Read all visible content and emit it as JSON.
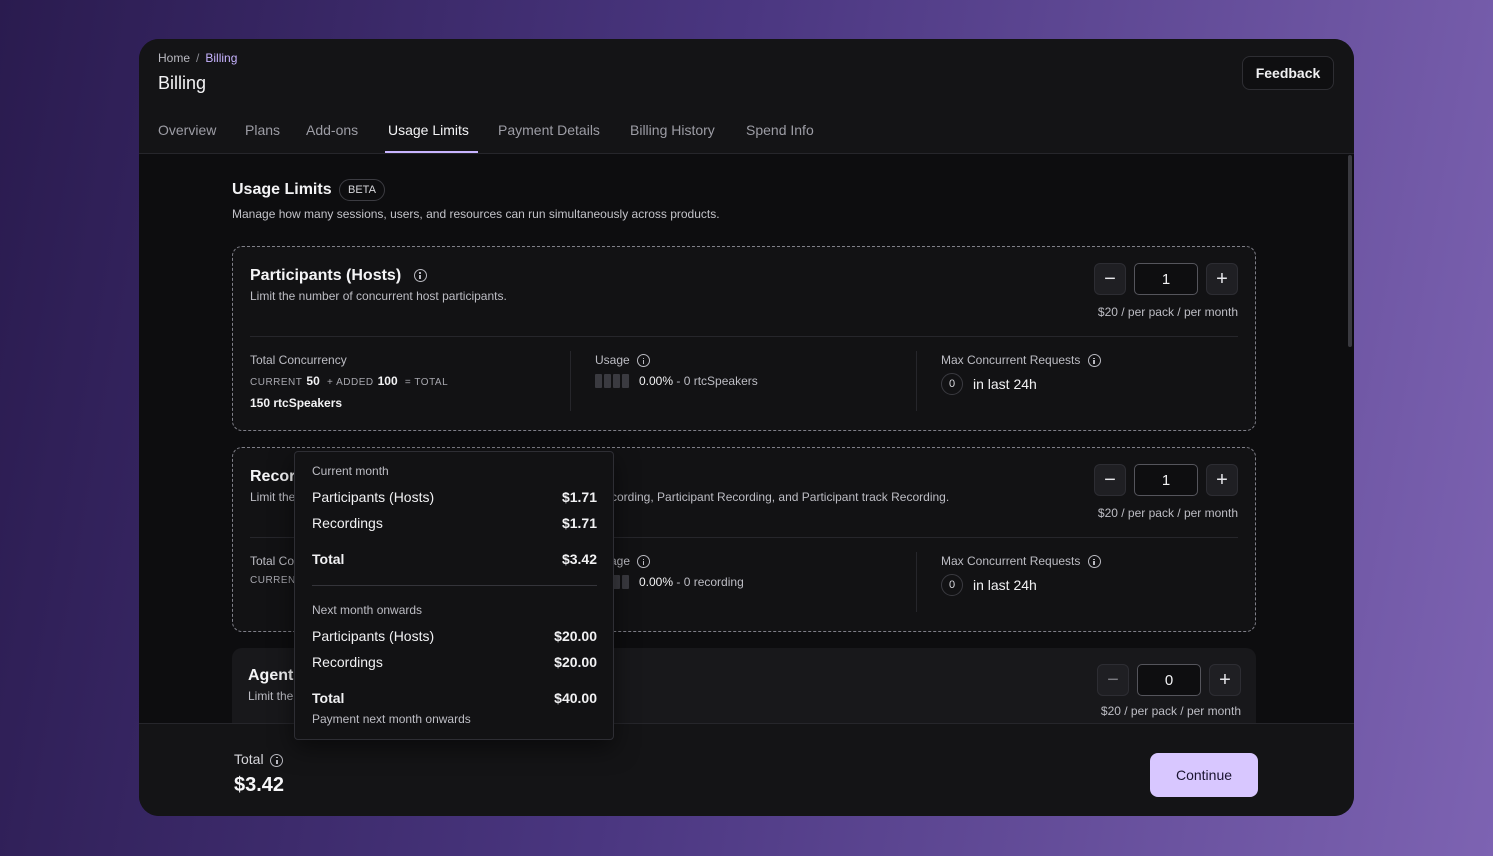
{
  "breadcrumb": {
    "home": "Home",
    "separator": "/",
    "current": "Billing"
  },
  "page_title": "Billing",
  "feedback_label": "Feedback",
  "tabs": [
    {
      "label": "Overview"
    },
    {
      "label": "Plans"
    },
    {
      "label": "Add-ons"
    },
    {
      "label": "Usage Limits",
      "active": true
    },
    {
      "label": "Payment Details"
    },
    {
      "label": "Billing History"
    },
    {
      "label": "Spend Info"
    }
  ],
  "section": {
    "title": "Usage Limits",
    "badge": "BETA",
    "description": "Manage how many sessions, users, and resources can run simultaneously across products."
  },
  "cards": [
    {
      "title": "Participants (Hosts)",
      "description": "Limit the number of concurrent host participants.",
      "quantity": "1",
      "price": "$20 / per pack / per month",
      "total_concurrency_label": "Total Concurrency",
      "current_label": "CURRENT",
      "current_value": "50",
      "added_label": "+ ADDED",
      "added_value": "100",
      "total_label": "= TOTAL",
      "total_value": "150 rtcSpeakers",
      "usage_label": "Usage",
      "usage_percent": "0.00%",
      "usage_detail": "- 0 rtcSpeakers",
      "max_label": "Max Concurrent Requests",
      "max_count": "0",
      "max_period": "in last 24h"
    },
    {
      "title": "Recor",
      "description": "Limit the",
      "description_tail": "cording, Participant Recording, and Participant track Recording.",
      "quantity": "1",
      "price": "$20 / per pack / per month",
      "total_concurrency_label": "Total Co",
      "current_label": "CURREN",
      "usage_label": "age",
      "usage_percent": "0.00%",
      "usage_detail": "- 0 recording",
      "max_label": "Max Concurrent Requests",
      "max_count": "0",
      "max_period": "in last 24h"
    },
    {
      "title": "Agent",
      "description": "Limit the",
      "quantity": "0",
      "price": "$20 / per pack / per month"
    }
  ],
  "popover": {
    "current_month_label": "Current month",
    "current_rows": [
      {
        "label": "Participants (Hosts)",
        "amount": "$1.71"
      },
      {
        "label": "Recordings",
        "amount": "$1.71"
      }
    ],
    "current_total_label": "Total",
    "current_total": "$3.42",
    "next_month_label": "Next month onwards",
    "next_rows": [
      {
        "label": "Participants (Hosts)",
        "amount": "$20.00"
      },
      {
        "label": "Recordings",
        "amount": "$20.00"
      }
    ],
    "next_total_label": "Total",
    "next_total": "$40.00",
    "footnote": "Payment next month onwards"
  },
  "footer": {
    "total_label": "Total",
    "total_value": "$3.42",
    "continue_label": "Continue"
  },
  "colors": {
    "accent": "#c8b4ff",
    "button": "#d8c7ff",
    "panel": "#0d0d0f"
  }
}
